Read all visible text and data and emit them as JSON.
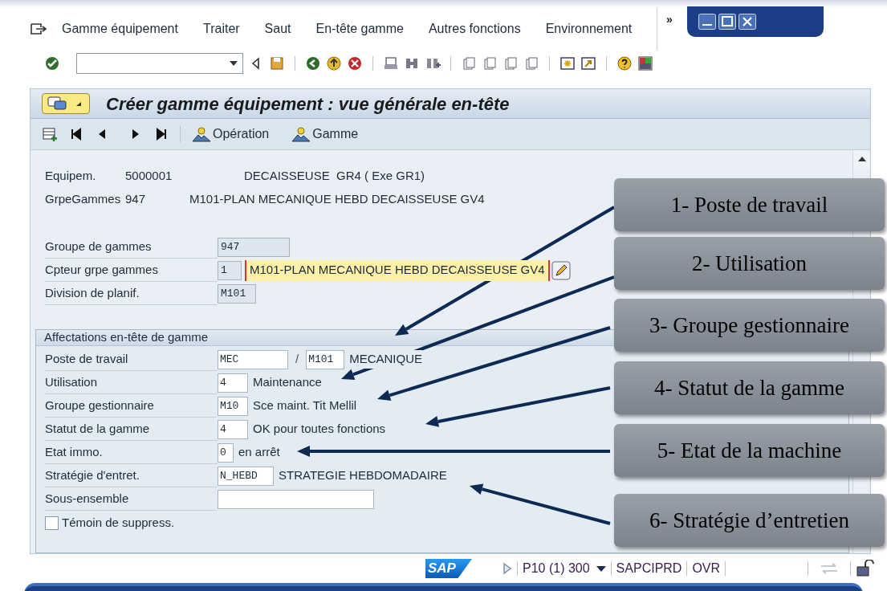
{
  "menu_bar": {
    "items": [
      "Gamme équipement",
      "Traiter",
      "Saut",
      "En-tête gamme",
      "Autres fonctions",
      "Environnement"
    ],
    "overflow": "»"
  },
  "title": "Créer gamme équipement : vue générale en-tête",
  "app_toolbar": [
    "Opération",
    "Gamme"
  ],
  "header_info": [
    {
      "label": "Equipem.",
      "value": "5000001",
      "description": "DECAISSEUSE  GR4 ( Exe GR1)"
    },
    {
      "label": "GrpeGammes",
      "value": "947",
      "description": "M101-PLAN MECANIQUE HEBD DECAISSEUSE GV4"
    }
  ],
  "top_fields": [
    {
      "label": "Groupe de gammes",
      "value": "947"
    },
    {
      "label": "Cpteur grpe gammes",
      "value": "1",
      "text_field": {
        "value": "M101-PLAN MECANIQUE HEBD DECAISSEUSE GV4",
        "focused": true
      }
    },
    {
      "label": "Division de planif.",
      "value": "M101"
    }
  ],
  "assignments": {
    "title": "Affectations en-tête de gamme",
    "rows": [
      {
        "label": "Poste de travail",
        "value": "MEC",
        "separator": "/",
        "value2": "M101",
        "description": "MECANIQUE"
      },
      {
        "label": "Utilisation",
        "value": "4",
        "description": "Maintenance"
      },
      {
        "label": "Groupe gestionnaire",
        "value": "M10",
        "description": "Sce maint. Tit Mellil"
      },
      {
        "label": "Statut de la gamme",
        "value": "4",
        "description": "OK pour toutes fonctions"
      },
      {
        "label": "Etat immo.",
        "value": "0",
        "description": "en arrêt"
      },
      {
        "label": "Stratégie d'entret.",
        "value": "N_HEBD",
        "description": "STRATEGIE HEBDOMADAIRE"
      },
      {
        "label": "Sous-ensemble"
      }
    ]
  },
  "deletion_flag": {
    "label": "Témoin de suppress.",
    "checked": false
  },
  "status_bar": {
    "logo": "SAP",
    "session": "P10 (1) 300",
    "server": "SAPCIPRD",
    "mode": "OVR"
  },
  "callouts": [
    "1- Poste de travail",
    "2- Utilisation",
    "3- Groupe gestionnaire",
    "4- Statut de la gamme",
    "5- Etat de la machine",
    "6- Stratégie d’entretien"
  ]
}
